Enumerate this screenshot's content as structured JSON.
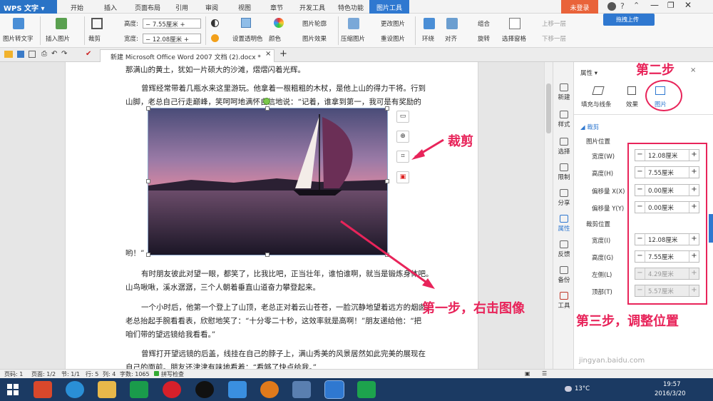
{
  "titlebar": {
    "app_menu": "WPS 文字",
    "tabs": [
      "开始",
      "插入",
      "页面布局",
      "引用",
      "审阅",
      "视图",
      "章节",
      "开发工具",
      "特色功能",
      "图片工具"
    ],
    "login": "未登录",
    "upload": "拖拽上传"
  },
  "ribbon": {
    "img_to_text": "图片转文字",
    "insert_img": "插入图片",
    "crop": "裁剪",
    "height_label": "高度:",
    "height_val": "7.55厘米",
    "width_label": "宽度:",
    "width_val": "12.08厘米",
    "set_transparent": "设置透明色",
    "color": "颜色",
    "img_outline": "图片轮廓",
    "img_effect": "图片效果",
    "compress": "压缩图片",
    "change_img": "更改图片",
    "reset_img": "重设图片",
    "wrap": "环绕",
    "align": "对齐",
    "group": "组合",
    "rotate": "旋转",
    "select_pane": "选择窗格",
    "up_one": "上移一层",
    "down_one": "下移一层"
  },
  "doc": {
    "tab_title": "新建 Microsoft Office Word 2007 文档 (2).docx *"
  },
  "content": {
    "p1": "那满山的黄土，犹如一片硕大的沙滩，熠熠闪着光辉。",
    "p2a": "曾辉经常带着几瓶水来这里游玩。他拿着一根粗粗的木杖，是他上山的得力干将。行到",
    "p2b": "山脚，老总自己行走巅峰，笑呵呵地满怀自信地说：“记着，谁拿到第一，我可是有奖励的",
    "p2c": "哟！”",
    "p3a": "有时朋友彼此对望一眼，都笑了，比我比吧，正当壮年，谁怕谁啊，就当是锻炼身体吧。",
    "p3b": "山鸟啾啾，溪水潺潺，三个人朝着垂直山道奋力攀登起来。",
    "p4a": "一个小时后，他第一个登上了山顶，老总正对着云山苍苍，一脸沉静地望着远方的烟囱。",
    "p4b": "老总抬起手腕看看表，欣慰地笑了：“十分零二十秒，这效率就是高啊！”朋友递给他：“把",
    "p4c": "咱们带的望远镜给我看看。”",
    "p5a": "曾辉打开望远镜的后盖，线挂在自己的脖子上，满山秀美的风景居然如此完美的展现在",
    "p5b": "自己的面前。朋友还津津有味地看着：“看够了快点给我。”"
  },
  "sidebar": {
    "items": [
      "新建",
      "样式",
      "选择",
      "限制",
      "分享",
      "属性",
      "反馈",
      "备份",
      "工具"
    ]
  },
  "panel": {
    "title": "属性",
    "tabs": [
      "填充与线条",
      "效果",
      "图片"
    ],
    "crop_section": "裁剪",
    "img_pos": "图片位置",
    "crop_pos": "裁剪位置",
    "rows1": [
      {
        "label": "宽度(W)",
        "value": "12.08厘米"
      },
      {
        "label": "高度(H)",
        "value": "7.55厘米"
      },
      {
        "label": "偏移量 X(X)",
        "value": "0.00厘米"
      },
      {
        "label": "偏移量 Y(Y)",
        "value": "0.00厘米"
      }
    ],
    "rows2": [
      {
        "label": "宽度(I)",
        "value": "12.08厘米"
      },
      {
        "label": "高度(G)",
        "value": "7.55厘米"
      },
      {
        "label": "左侧(L)",
        "value": "4.29厘米"
      },
      {
        "label": "顶部(T)",
        "value": "5.57厘米"
      }
    ]
  },
  "status": {
    "page_num": "页码: 1",
    "pages": "页面: 1/2",
    "section": "节: 1/1",
    "row": "行: 5",
    "col": "列: 4",
    "words": "字数: 1065",
    "spell": "拼写检查"
  },
  "taskbar": {
    "temp": "13°C",
    "time": "19:57",
    "date": "2016/3/20"
  },
  "annotations": {
    "step1": "第一步，右击图像",
    "step2": "第二步",
    "step3": "第三步，调整位置",
    "crop": "裁剪"
  },
  "watermark": {
    "site": "jingyan.baidu.com"
  },
  "colors": {
    "accent": "#2f78d0",
    "annotation": "#e8245a",
    "login": "#e9633a"
  }
}
